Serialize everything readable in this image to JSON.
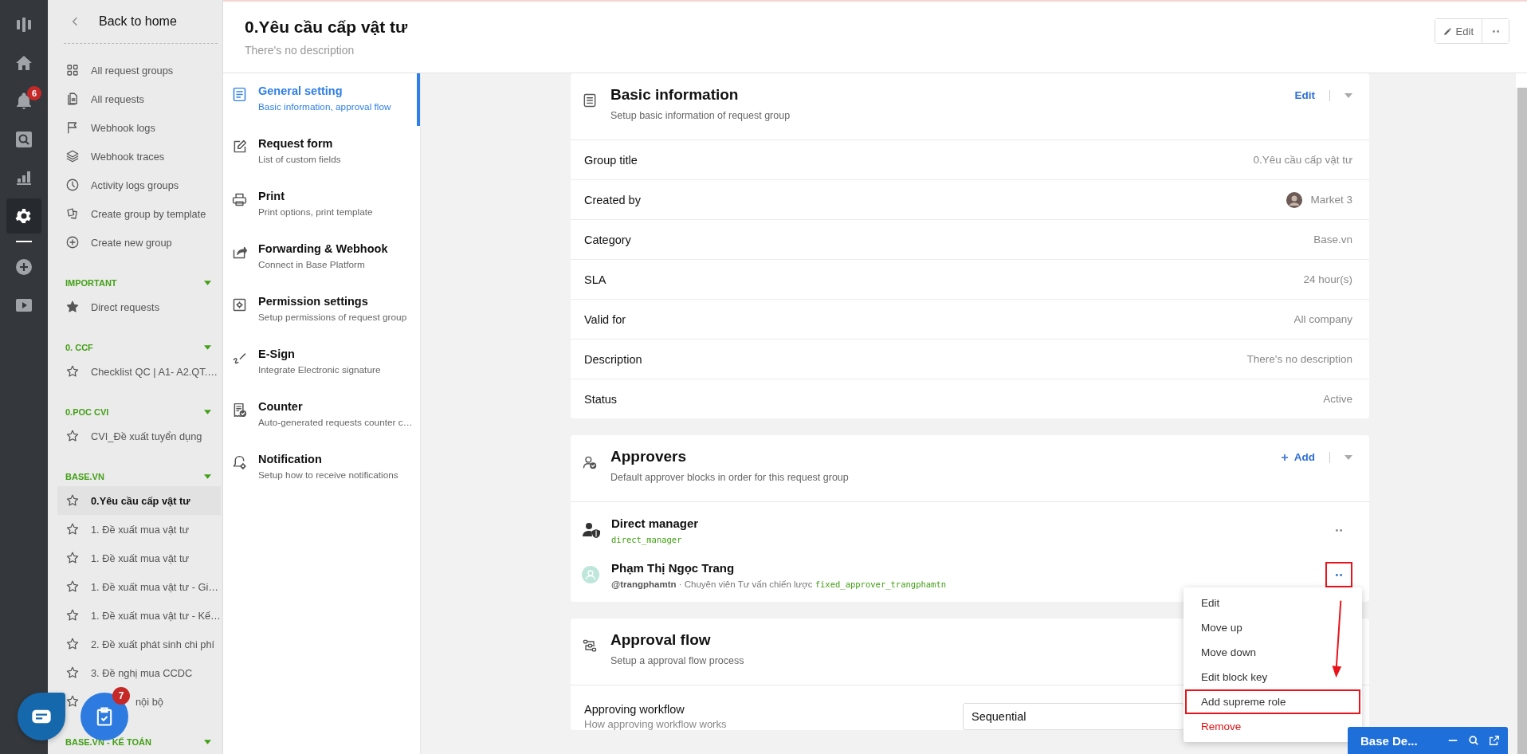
{
  "rail": [
    {
      "kind": "logo",
      "selected": false
    },
    {
      "kind": "home",
      "selected": false
    },
    {
      "kind": "bell",
      "selected": false,
      "badge": "6"
    },
    {
      "kind": "search",
      "selected": false
    },
    {
      "kind": "chart",
      "selected": false
    },
    {
      "kind": "settings",
      "selected": true
    },
    {
      "kind": "separator"
    },
    {
      "kind": "add",
      "selected": false
    },
    {
      "kind": "video",
      "selected": false
    }
  ],
  "sidebar": {
    "back": "Back to home",
    "menu": [
      {
        "kind": "grid",
        "label": "All request groups"
      },
      {
        "kind": "document",
        "label": "All requests"
      },
      {
        "kind": "flag",
        "label": "Webhook logs"
      },
      {
        "kind": "layers",
        "label": "Webhook traces"
      },
      {
        "kind": "clock",
        "label": "Activity logs groups"
      },
      {
        "kind": "template",
        "label": "Create group by template"
      },
      {
        "kind": "plus",
        "label": "Create new group"
      }
    ],
    "sections": [
      {
        "title": "IMPORTANT",
        "expanded": true,
        "items": [
          {
            "label": "Direct requests",
            "starred": true,
            "selected": false
          }
        ]
      },
      {
        "title": "0. CCF",
        "expanded": true,
        "items": [
          {
            "label": "Checklist QC | A1- A2.QT.…",
            "starred": false,
            "selected": false
          }
        ]
      },
      {
        "title": "0.POC CVI",
        "expanded": true,
        "items": [
          {
            "label": "CVI_Đề xuất tuyển dụng",
            "starred": false,
            "selected": false
          }
        ]
      },
      {
        "title": "BASE.VN",
        "expanded": true,
        "items": [
          {
            "label": "0.Yêu cầu cấp vật tư",
            "starred": false,
            "selected": true
          },
          {
            "label": "1. Đề xuất mua vật tư",
            "starred": false,
            "selected": false
          },
          {
            "label": "1. Đề xuất mua vật tư",
            "starred": false,
            "selected": false
          },
          {
            "label": "1. Đề xuất mua vật tư - Gi…",
            "starred": false,
            "selected": false
          },
          {
            "label": "1. Đề xuất mua vật tư - Kế…",
            "starred": false,
            "selected": false
          },
          {
            "label": "2. Đề xuất phát sinh chi phí",
            "starred": false,
            "selected": false
          },
          {
            "label": "3. Đề nghị mua CCDC",
            "starred": false,
            "selected": false
          },
          {
            "label": "nội bộ",
            "starred": false,
            "selected": false,
            "kind": "partial"
          }
        ]
      },
      {
        "title": "BASE.VN - KẾ TOÁN",
        "expanded": true
      }
    ]
  },
  "header": {
    "title": "0.Yêu cầu cấp vật tư",
    "description": "There's no description",
    "edit": "Edit"
  },
  "settings_nav": [
    {
      "kind": "general",
      "title": "General setting",
      "subtitle": "Basic information, approval flow",
      "selected": true
    },
    {
      "kind": "form",
      "title": "Request form",
      "subtitle": "List of custom fields",
      "selected": false
    },
    {
      "kind": "print",
      "title": "Print",
      "subtitle": "Print options, print template",
      "selected": false
    },
    {
      "kind": "forward",
      "title": "Forwarding & Webhook",
      "subtitle": "Connect in Base Platform",
      "selected": false
    },
    {
      "kind": "permission",
      "title": "Permission settings",
      "subtitle": "Setup permissions of request group",
      "selected": false
    },
    {
      "kind": "esign",
      "title": "E-Sign",
      "subtitle": "Integrate Electronic signature",
      "selected": false
    },
    {
      "kind": "counter",
      "title": "Counter",
      "subtitle": "Auto-generated requests counter c…",
      "selected": false
    },
    {
      "kind": "notification",
      "title": "Notification",
      "subtitle": "Setup how to receive notifications",
      "selected": false
    }
  ],
  "basic_information": {
    "title": "Basic information",
    "subtitle": "Setup basic information of request group",
    "action": "Edit",
    "rows": [
      {
        "label": "Group title",
        "value": "0.Yêu cầu cấp vật tư"
      },
      {
        "label": "Created by",
        "value": "Market 3",
        "kind": "user"
      },
      {
        "label": "Category",
        "value": "Base.vn"
      },
      {
        "label": "SLA",
        "value": "24 hour(s)"
      },
      {
        "label": "Valid for",
        "value": "All company"
      },
      {
        "label": "Description",
        "value": "There's no description"
      },
      {
        "label": "Status",
        "value": "Active"
      }
    ]
  },
  "approvers": {
    "title": "Approvers",
    "subtitle": "Default approver blocks in order for this request group",
    "action": "Add",
    "blocks": [
      {
        "kind": "role",
        "name": "Direct manager",
        "key": "direct_manager",
        "highlighted": false
      },
      {
        "kind": "person",
        "name": "Phạm Thị Ngọc Trang",
        "details": "**@trangphamtn** · Chuyên viên Tư vấn chiến lược",
        "key": "fixed_approver_trangphamtn",
        "highlighted": true,
        "menu": [
          {
            "label": "Edit",
            "danger": false,
            "highlighted": false
          },
          {
            "label": "Move up",
            "danger": false,
            "highlighted": false
          },
          {
            "label": "Move down",
            "danger": false,
            "highlighted": false
          },
          {
            "label": "Edit block key",
            "danger": false,
            "highlighted": false
          },
          {
            "label": "Add supreme role",
            "danger": false,
            "highlighted": true
          },
          {
            "label": "Remove",
            "danger": true,
            "highlighted": false
          }
        ]
      }
    ]
  },
  "approval_flow": {
    "title": "Approval flow",
    "subtitle": "Setup a approval flow process",
    "fields": [
      {
        "label": "Approving workflow",
        "hint": "How approving workflow works",
        "value": "Sequential"
      }
    ]
  },
  "chat_widget": {
    "title": "Base De..."
  },
  "task_badge": "7"
}
